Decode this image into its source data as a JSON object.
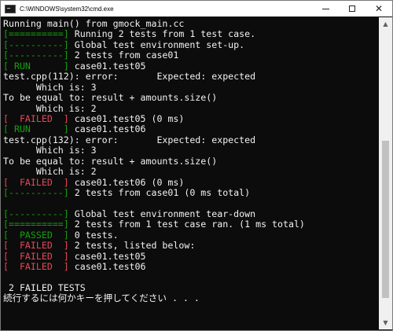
{
  "window": {
    "title": "C:\\WINDOWS\\system32\\cmd.exe",
    "controls": {
      "minimize": "minimize",
      "maximize": "maximize",
      "close": "✕"
    }
  },
  "console": {
    "lines": [
      {
        "tag": "",
        "text": "Running main() from gmock_main.cc"
      },
      {
        "tag": "[==========]",
        "tag_color": "green",
        "text": " Running 2 tests from 1 test case."
      },
      {
        "tag": "[----------]",
        "tag_color": "green",
        "text": " Global test environment set-up."
      },
      {
        "tag": "[----------]",
        "tag_color": "green",
        "text": " 2 tests from case01"
      },
      {
        "tag": "[ RUN      ]",
        "tag_color": "green",
        "text": " case01.test05"
      },
      {
        "tag": "",
        "text": "test.cpp(112): error:       Expected: expected"
      },
      {
        "tag": "",
        "text": "      Which is: 3"
      },
      {
        "tag": "",
        "text": "To be equal to: result + amounts.size()"
      },
      {
        "tag": "",
        "text": "      Which is: 2"
      },
      {
        "tag": "[  FAILED  ]",
        "tag_color": "red",
        "text": " case01.test05 (0 ms)"
      },
      {
        "tag": "[ RUN      ]",
        "tag_color": "green",
        "text": " case01.test06"
      },
      {
        "tag": "",
        "text": "test.cpp(132): error:       Expected: expected"
      },
      {
        "tag": "",
        "text": "      Which is: 3"
      },
      {
        "tag": "",
        "text": "To be equal to: result + amounts.size()"
      },
      {
        "tag": "",
        "text": "      Which is: 2"
      },
      {
        "tag": "[  FAILED  ]",
        "tag_color": "red",
        "text": " case01.test06 (0 ms)"
      },
      {
        "tag": "[----------]",
        "tag_color": "green",
        "text": " 2 tests from case01 (0 ms total)"
      },
      {
        "tag": "",
        "text": ""
      },
      {
        "tag": "[----------]",
        "tag_color": "green",
        "text": " Global test environment tear-down"
      },
      {
        "tag": "[==========]",
        "tag_color": "green",
        "text": " 2 tests from 1 test case ran. (1 ms total)"
      },
      {
        "tag": "[  PASSED  ]",
        "tag_color": "green",
        "text": " 0 tests."
      },
      {
        "tag": "[  FAILED  ]",
        "tag_color": "red",
        "text": " 2 tests, listed below:"
      },
      {
        "tag": "[  FAILED  ]",
        "tag_color": "red",
        "text": " case01.test05"
      },
      {
        "tag": "[  FAILED  ]",
        "tag_color": "red",
        "text": " case01.test06"
      },
      {
        "tag": "",
        "text": ""
      },
      {
        "tag": "",
        "text": " 2 FAILED TESTS"
      },
      {
        "tag": "",
        "text": "続行するには何かキーを押してください . . ."
      }
    ]
  },
  "scrollbar": {
    "up_arrow": "▲",
    "down_arrow": "▼"
  },
  "colors": {
    "console_bg": "#0c0c0c",
    "console_text": "#f2f2f2",
    "tag_green": "#13a10e",
    "tag_red": "#e74856"
  }
}
